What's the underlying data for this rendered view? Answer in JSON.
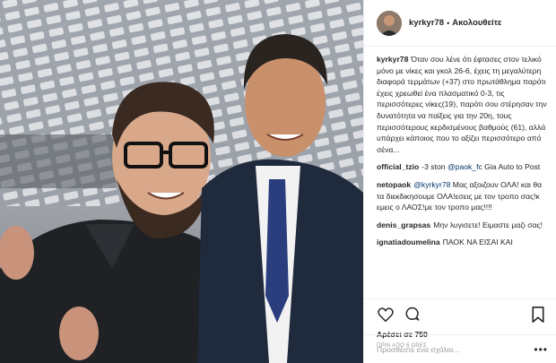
{
  "post": {
    "username": "kyrkyr78",
    "separator": "•",
    "follow_label": "Ακολουθείτε",
    "caption_user": "kyrkyr78",
    "caption_text": "Όταν σου λένε ότι έφτασες στον τελικό μόνο με νίκες και γκολ 26-6, έχεις τη μεγαλύτερη διαφορά τερμάτων (+37) στο πρωτάθλημα παρότι έχεις χρεωθεί ένα πλασματικό 0-3, τις περισσότερες νίκες(19), παρότι σου στέρησαν την δυνατότητα να παίξεις για την 20η, τους περισσότερους κερδισμένους βαθμούς (61), αλλά υπάρχει κάποιος που το αξίζει περισσότερο από σένα...",
    "comments": [
      {
        "user": "official_tzio",
        "pre": "-3 ston ",
        "mention": "@paok_fc",
        "post": " Gia Auto to Post"
      },
      {
        "user": "netopaok",
        "pre": "",
        "mention": "@kyrkyr78",
        "post": " Μας αξοιζουν ΟΛΑ! και θα τα διεκδικησουμε ΟΛΑ!εσεις με τον τροπο σας!κ εμεις ο ΛΑΟΣ!με τον τροπο μας!!!!"
      },
      {
        "user": "denis_grapsas",
        "pre": "Μην λυγισετε! Ειμαστε μαζι σας!",
        "mention": "",
        "post": ""
      },
      {
        "user": "ignatiadoumelina",
        "pre": "ΠΑΟΚ ΝΑ ΕΙΣΑΙ ΚΑΙ",
        "mention": "",
        "post": ""
      }
    ],
    "likes_text": "Αρέσει σε 750",
    "timestamp": "ΠΡΙΝ ΑΠΟ 6 ΩΡΕΣ",
    "add_comment_placeholder": "Προσθέστε ένα σχόλιο...",
    "more_label": "•••"
  },
  "icons": {
    "like": "heart-icon",
    "comment": "comment-bubble-icon",
    "save": "bookmark-icon",
    "more": "more-options-icon"
  },
  "colors": {
    "text": "#262626",
    "muted": "#999999",
    "mention": "#003569",
    "border": "#efefef"
  }
}
